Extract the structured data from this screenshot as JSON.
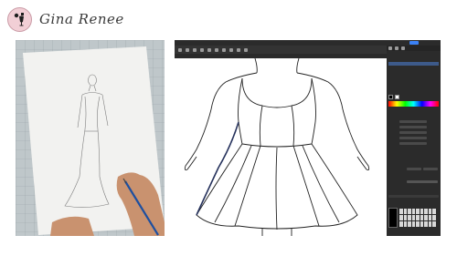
{
  "brand": {
    "name": "Gina Renee",
    "logo_icon": "dress-form-icon",
    "logo_color": "#f2cfd6"
  },
  "photo": {
    "subject": "pencil-sketch-paper",
    "icon": "hand-drawing-icon"
  },
  "app": {
    "colors": {
      "chrome": "#2b2b2b",
      "accent": "#3b82f6",
      "stroke": "#222233"
    }
  }
}
